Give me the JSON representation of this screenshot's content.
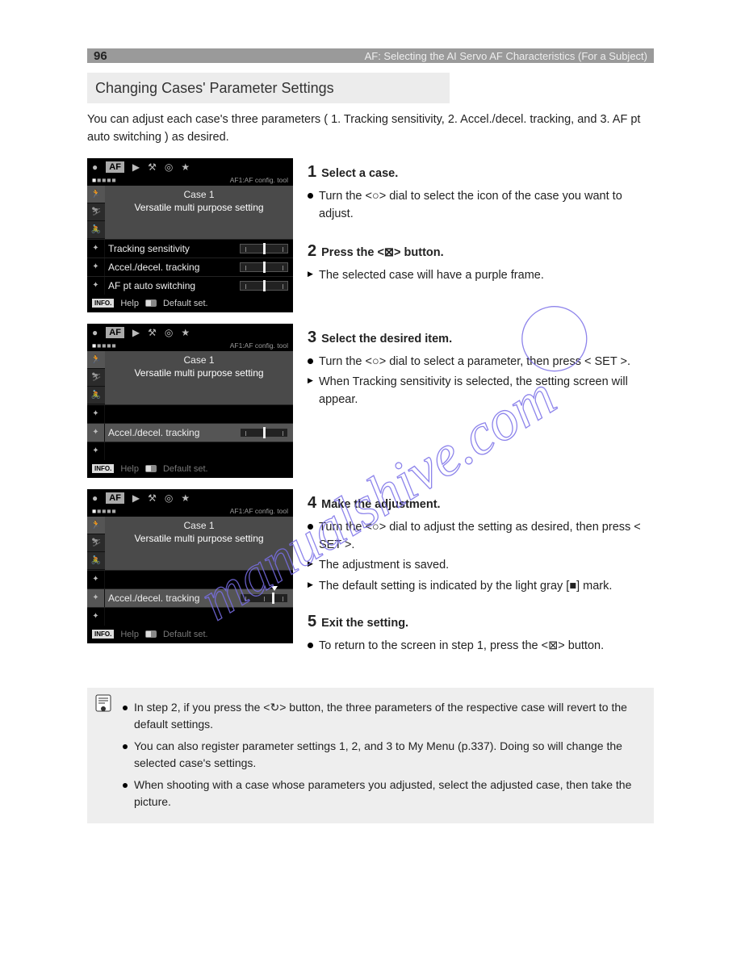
{
  "page_number": "96",
  "header": {
    "af_label": "AF",
    "title_suffix": ": Selecting the AI Servo AF Characteristics (For a Subject)"
  },
  "section_title": "Changing Cases' Parameter Settings",
  "intro": "You can adjust each case's three parameters ( 1. Tracking sensitivity, 2. Accel./decel. tracking, and 3. AF pt auto switching ) as desired.",
  "steps": {
    "s1": {
      "num": "1",
      "heading": "Select a case.",
      "bullet": "Turn the <○> dial to select the icon of the case you want to adjust."
    },
    "s2": {
      "num": "2",
      "heading": "Press the <⊠> button.",
      "bullet": "The selected case will have a purple frame."
    },
    "s3": {
      "num": "3",
      "heading": "Select the desired item.",
      "bullets": [
        "Turn the <○> dial to select a parameter, then press < SET >.",
        "When Tracking sensitivity is selected, the setting screen will appear."
      ]
    },
    "s4": {
      "num": "4",
      "heading": "Make the adjustment.",
      "bullets": [
        "Turn the <○> dial to adjust the setting as desired, then press < SET >.",
        "The adjustment is saved.",
        "The default setting is indicated by the light gray [■] mark."
      ]
    },
    "s5": {
      "num": "5",
      "heading": "Exit the setting.",
      "bullets": [
        "To return to the screen in step 1, press the <⊠> button."
      ]
    }
  },
  "lcd": {
    "tab_camera": "●",
    "tab_af": "AF",
    "tab_play": "▶",
    "tab_wrench": "⚒",
    "tab_custom": "◎",
    "tab_star": "★",
    "subtab_label": "AF1:AF config. tool",
    "case_title": "Case 1",
    "case_desc": "Versatile multi purpose setting",
    "row1": "Tracking sensitivity",
    "row2": "Accel./decel. tracking",
    "row3": "AF pt auto switching",
    "footer_info": "INFO.",
    "footer_help": "Help",
    "footer_default": "Default set."
  },
  "note": {
    "items": [
      "In step 2, if you press the <↻> button, the three parameters of the respective case will revert to the default settings.",
      "You can also register parameter settings 1, 2, and 3 to My Menu (p.337). Doing so will change the selected case's settings."
    ],
    "extra": "When shooting with a case whose parameters you adjusted, select the adjusted case, then take the picture."
  },
  "watermark_text": "manualshive.com"
}
